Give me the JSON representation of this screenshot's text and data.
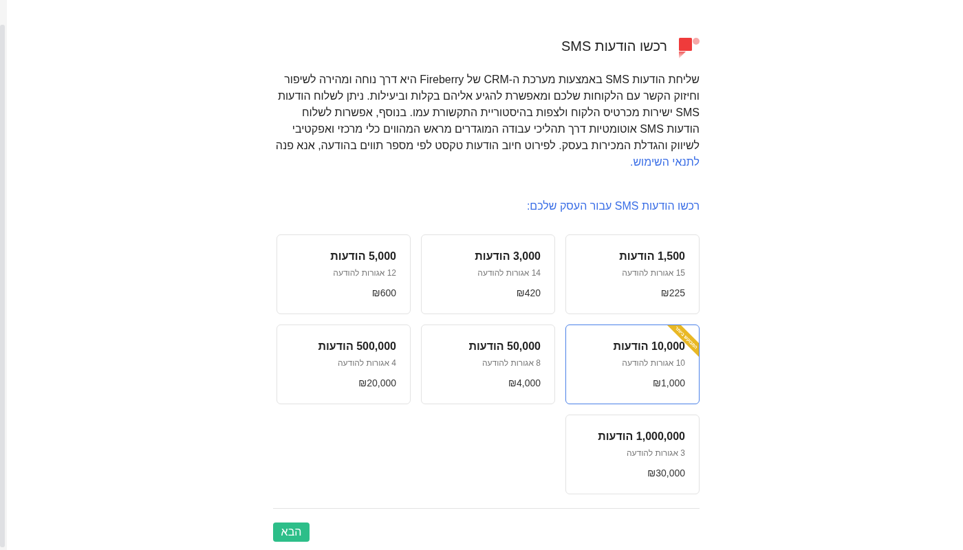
{
  "header": {
    "title": "רכשו הודעות SMS"
  },
  "description": {
    "text": "שליחת הודעות SMS באמצעות מערכת ה-CRM של Fireberry היא דרך נוחה ומהירה לשיפור וחיזוק הקשר עם הלקוחות שלכם ומאפשרת להגיע אליהם בקלות וביעילות. ניתן לשלוח הודעות SMS ישירות מכרטיס הלקוח ולצפות בהיסטוריית התקשורת עמו. בנוסף, אפשרות לשלוח הודעות SMS אוטומטיות דרך תהליכי עבודה המוגדרים מראש המהווים כלי מרכזי ואפקטיבי לשיווק והגדלת המכירות בעסק. לפירוט חיוב הודעות טקסט לפי מספר תווים בהודעה, אנא פנה",
    "link": "לתנאי השימוש."
  },
  "packages_title": "רכשו הודעות SMS עבור העסק שלכם:",
  "packages": [
    {
      "title": "1,500 הודעות",
      "rate": "15 אגורות להודעה",
      "price": "₪225",
      "selected": false
    },
    {
      "title": "3,000 הודעות",
      "rate": "14 אגורות להודעה",
      "price": "₪420",
      "selected": false
    },
    {
      "title": "5,000 הודעות",
      "rate": "12 אגורות להודעה",
      "price": "₪600",
      "selected": false
    },
    {
      "title": "10,000 הודעות",
      "rate": "10 אגורות להודעה",
      "price": "₪1,000",
      "selected": true,
      "badge": "המבוקש ביותר"
    },
    {
      "title": "50,000 הודעות",
      "rate": "8 אגורות להודעה",
      "price": "₪4,000",
      "selected": false
    },
    {
      "title": "500,000 הודעות",
      "rate": "4 אגורות להודעה",
      "price": "₪20,000",
      "selected": false
    },
    {
      "title": "1,000,000 הודעות",
      "rate": "3 אגורות להודעה",
      "price": "₪30,000",
      "selected": false
    }
  ],
  "next_button": "הבא"
}
